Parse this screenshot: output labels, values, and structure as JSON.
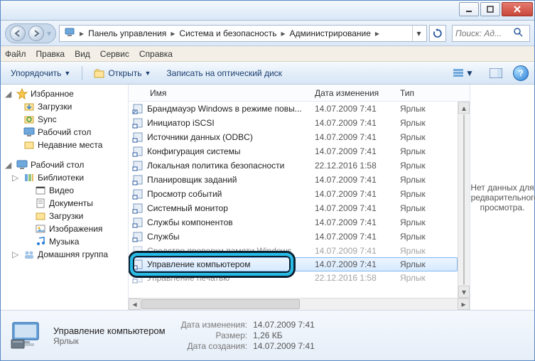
{
  "search": {
    "placeholder": "Поиск: Ад..."
  },
  "breadcrumb": {
    "seg1": "Панель управления",
    "seg2": "Система и безопасность",
    "seg3": "Администрирование"
  },
  "menu": {
    "file": "Файл",
    "edit": "Правка",
    "view": "Вид",
    "tools": "Сервис",
    "help": "Справка"
  },
  "cmd": {
    "organize": "Упорядочить",
    "open": "Открыть",
    "burn": "Записать на оптический диск"
  },
  "nav": {
    "favorites": "Избранное",
    "downloads": "Загрузки",
    "sync": "Sync",
    "desktop": "Рабочий стол",
    "recent": "Недавние места",
    "desktop2": "Рабочий стол",
    "libraries": "Библиотеки",
    "videos": "Видео",
    "documents": "Документы",
    "downloads2": "Загрузки",
    "pictures": "Изображения",
    "music": "Музыка",
    "homegroup": "Домашняя группа"
  },
  "columns": {
    "name": "Имя",
    "date": "Дата изменения",
    "type": "Тип"
  },
  "typeShortcut": "Ярлык",
  "files": {
    "0": {
      "name": "Брандмауэр Windows в режиме повы...",
      "date": "14.07.2009 7:41"
    },
    "1": {
      "name": "Инициатор iSCSI",
      "date": "14.07.2009 7:41"
    },
    "2": {
      "name": "Источники данных (ODBC)",
      "date": "14.07.2009 7:41"
    },
    "3": {
      "name": "Конфигурация системы",
      "date": "14.07.2009 7:41"
    },
    "4": {
      "name": "Локальная политика безопасности",
      "date": "22.12.2016 1:58"
    },
    "5": {
      "name": "Планировщик заданий",
      "date": "14.07.2009 7:41"
    },
    "6": {
      "name": "Просмотр событий",
      "date": "14.07.2009 7:41"
    },
    "7": {
      "name": "Системный монитор",
      "date": "14.07.2009 7:41"
    },
    "8": {
      "name": "Службы компонентов",
      "date": "14.07.2009 7:41"
    },
    "9": {
      "name": "Службы",
      "date": "14.07.2009 7:41"
    },
    "10": {
      "name": "Средство проверки памяти Windows",
      "date": "14.07.2009 7:41"
    },
    "11": {
      "name": "Управление компьютером",
      "date": "14.07.2009 7:41"
    },
    "12": {
      "name": "Управление печатью",
      "date": "22.12.2016 1:58"
    }
  },
  "preview": {
    "empty": "Нет данных для предварительного просмотра."
  },
  "details": {
    "title": "Управление компьютером",
    "subtitle": "Ярлык",
    "modKey": "Дата изменения:",
    "modVal": "14.07.2009 7:41",
    "sizeKey": "Размер:",
    "sizeVal": "1,26 КБ",
    "createdKey": "Дата создания:",
    "createdVal": "14.07.2009 7:41"
  }
}
